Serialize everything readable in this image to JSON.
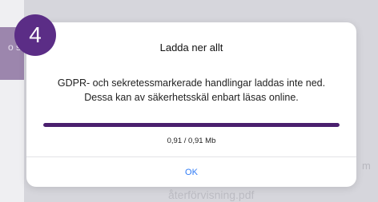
{
  "step_badge": "4",
  "dialog": {
    "title": "Ladda ner allt",
    "message_line1": "GDPR- och sekretessmarkerade handlingar laddas inte ned.",
    "message_line2": "Dessa kan av säkerhetsskäl enbart läsas online.",
    "progress_fraction": 1.0,
    "progress_text": "0,91 / 0,91 Mb",
    "ok_label": "OK"
  },
  "background": {
    "left_text": "o st",
    "right_text": "m",
    "bottom_text": "återförvisning.pdf"
  },
  "colors": {
    "accent_purple": "#5b2d86",
    "progress_fill": "#4a1f6e",
    "ok_blue": "#2f7bf6"
  }
}
